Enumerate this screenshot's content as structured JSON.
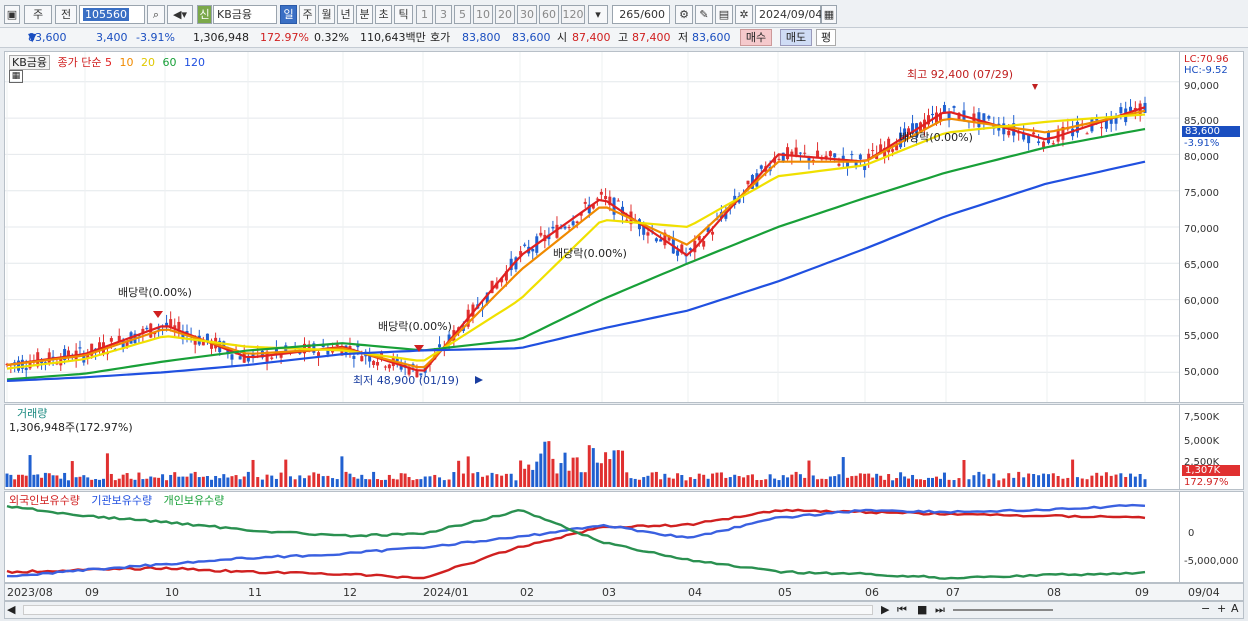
{
  "toolbar": {
    "period_stock": "주",
    "period_prev": "전",
    "code": "105560",
    "credit": "신",
    "name": "KB금융",
    "tabs": [
      "일",
      "주",
      "월",
      "년",
      "분",
      "초",
      "틱"
    ],
    "intervals": [
      "1",
      "3",
      "5",
      "10",
      "20",
      "30",
      "60",
      "120"
    ],
    "count": "265",
    "count_total": "/600",
    "date": "2024/09/04"
  },
  "quote": {
    "price": "83,600",
    "change": "3,400",
    "change_pct": "-3.91%",
    "volume": "1,306,948",
    "vol_ratio": "172.97%",
    "turnover": "0.32%",
    "amount": "110,643백만",
    "ask_label": "호가",
    "ask": "83,800",
    "bid": "83,600",
    "open_label": "시",
    "open": "87,400",
    "high_label": "고",
    "high": "87,400",
    "low_label": "저",
    "low": "83,600",
    "buy": "매수",
    "sell": "매도",
    "avg": "평"
  },
  "legend": {
    "name": "KB금융",
    "close": "종가 단순",
    "ma": [
      "5",
      "10",
      "20",
      "60",
      "120"
    ]
  },
  "annotations": {
    "high": "최고 92,400 (07/29)",
    "low": "최저 48,900 (01/19)",
    "div1": "배당락(0.00%)",
    "div2": "배당락(0.00%)",
    "div3": "배당락(0.00%)",
    "div4": "배당락(0.00%)"
  },
  "price_axis": {
    "lc": "LC:70.96",
    "hc": "HC:-9.52",
    "ticks": [
      "90,000",
      "85,000",
      "80,000",
      "75,000",
      "70,000",
      "65,000",
      "60,000",
      "55,000",
      "50,000"
    ],
    "current": "83,600",
    "current_pct": "-3.91%"
  },
  "volume_panel": {
    "title": "거래량",
    "value": "1,306,948주(172.97%)",
    "ticks": [
      "7,500K",
      "5,000K",
      "2,500K"
    ],
    "current": "1,307K",
    "current_pct": "172.97%"
  },
  "holdings_panel": {
    "foreign": "외국인보유수량",
    "inst": "기관보유수량",
    "indiv": "개인보유수량",
    "ticks": [
      "0",
      "-5,000,000"
    ]
  },
  "x_axis": {
    "labels": [
      "2023/08",
      "09",
      "10",
      "11",
      "12",
      "2024/01",
      "02",
      "03",
      "04",
      "05",
      "06",
      "07",
      "08",
      "09"
    ],
    "right": "09/04"
  },
  "colors": {
    "up": "#e03030",
    "down": "#2060d0",
    "ma5": "#e02020",
    "ma10": "#f08a00",
    "ma20": "#f0e000",
    "ma60": "#18a038",
    "ma120": "#2050e0"
  },
  "chart_data": {
    "type": "line",
    "title": "KB금융",
    "x": [
      "2023/08",
      "09",
      "10",
      "11",
      "12",
      "2024/01",
      "02",
      "03",
      "04",
      "05",
      "06",
      "07",
      "08",
      "09"
    ],
    "series": [
      {
        "name": "5",
        "values": [
          51000,
          52500,
          56500,
          52000,
          53500,
          50000,
          66000,
          74000,
          66000,
          80000,
          79000,
          86000,
          82000,
          86500
        ]
      },
      {
        "name": "10",
        "values": [
          51000,
          52300,
          56000,
          52500,
          53300,
          50500,
          64000,
          73000,
          67500,
          79000,
          79000,
          85000,
          83000,
          86000
        ]
      },
      {
        "name": "20",
        "values": [
          50500,
          51800,
          55000,
          53500,
          53000,
          51500,
          60000,
          71000,
          70000,
          77000,
          78500,
          83000,
          84500,
          85500
        ]
      },
      {
        "name": "60",
        "values": [
          49000,
          49800,
          51500,
          53000,
          54000,
          53000,
          54500,
          60000,
          65000,
          70000,
          74000,
          77500,
          81000,
          83500
        ]
      },
      {
        "name": "120",
        "values": [
          48800,
          49300,
          50000,
          51000,
          52500,
          53000,
          53300,
          56000,
          58500,
          62500,
          67000,
          71500,
          76000,
          79000
        ]
      }
    ],
    "ylim": [
      47000,
      93000
    ],
    "high": {
      "value": 92400,
      "date": "07/29"
    },
    "low": {
      "value": 48900,
      "date": "01/19"
    }
  }
}
